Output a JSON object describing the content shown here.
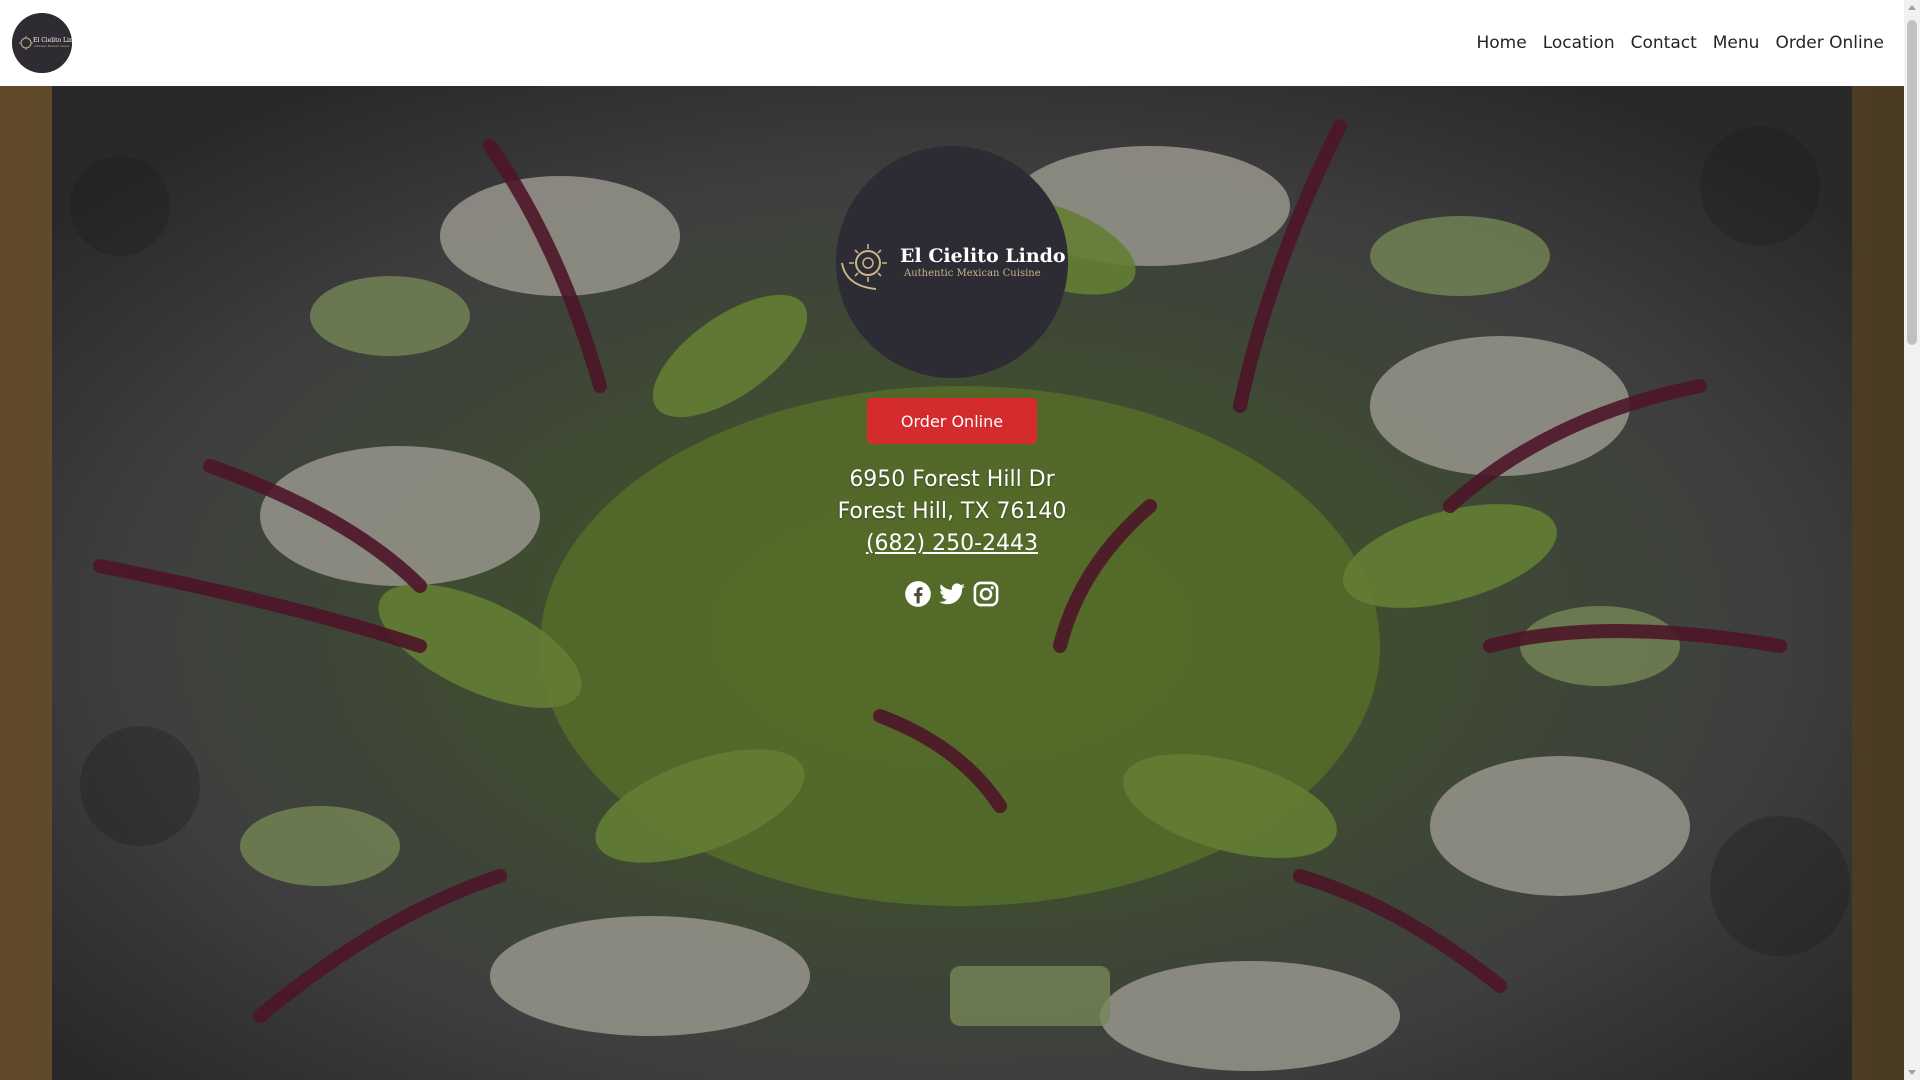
{
  "brand": {
    "logo_icon": "el-cielito-lindo-logo",
    "logo_name": "El Cielito Lindo",
    "logo_tagline": "Authentic Mexican Cuisine"
  },
  "nav": {
    "items": [
      {
        "label": "Home"
      },
      {
        "label": "Location"
      },
      {
        "label": "Contact"
      },
      {
        "label": "Menu"
      },
      {
        "label": "Order Online"
      }
    ]
  },
  "hero": {
    "order_button_label": "Order Online",
    "address_line1": "6950 Forest Hill Dr",
    "address_line2": "Forest Hill, TX 76140",
    "phone": "(682) 250-2443",
    "social_icons": [
      "facebook-icon",
      "twitter-icon",
      "instagram-icon"
    ]
  },
  "colors": {
    "accent": "#d42b2f",
    "logo_bg": "#2d2b33",
    "text_on_hero": "#ffffff"
  }
}
